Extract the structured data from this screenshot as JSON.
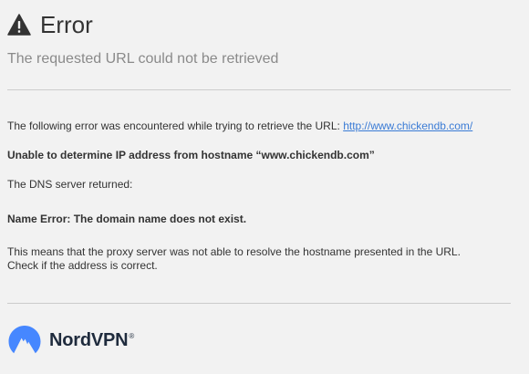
{
  "header": {
    "title": "Error",
    "subtitle": "The requested URL could not be retrieved"
  },
  "body": {
    "intro_text": "The following error was encountered while trying to retrieve the URL: ",
    "url_link": "http://www.chickendb.com/",
    "error_heading": "Unable to determine IP address from hostname “www.chickendb.com”",
    "dns_label": "The DNS server returned:",
    "dns_error": "Name Error: The domain name does not exist.",
    "explain_line1": "This means that the proxy server was not able to resolve the hostname presented in the URL.",
    "explain_line2": "Check if the address is correct."
  },
  "footer": {
    "brand_name": "NordVPN",
    "brand_reg": "®"
  },
  "icons": {
    "warning": "warning-triangle-icon",
    "brand_logo": "nordvpn-mountain-logo"
  },
  "colors": {
    "background": "#f2f2f2",
    "link": "#3a7bd5",
    "brand_blue": "#4687ff",
    "text": "#333333",
    "subtitle": "#8a8a8a"
  }
}
